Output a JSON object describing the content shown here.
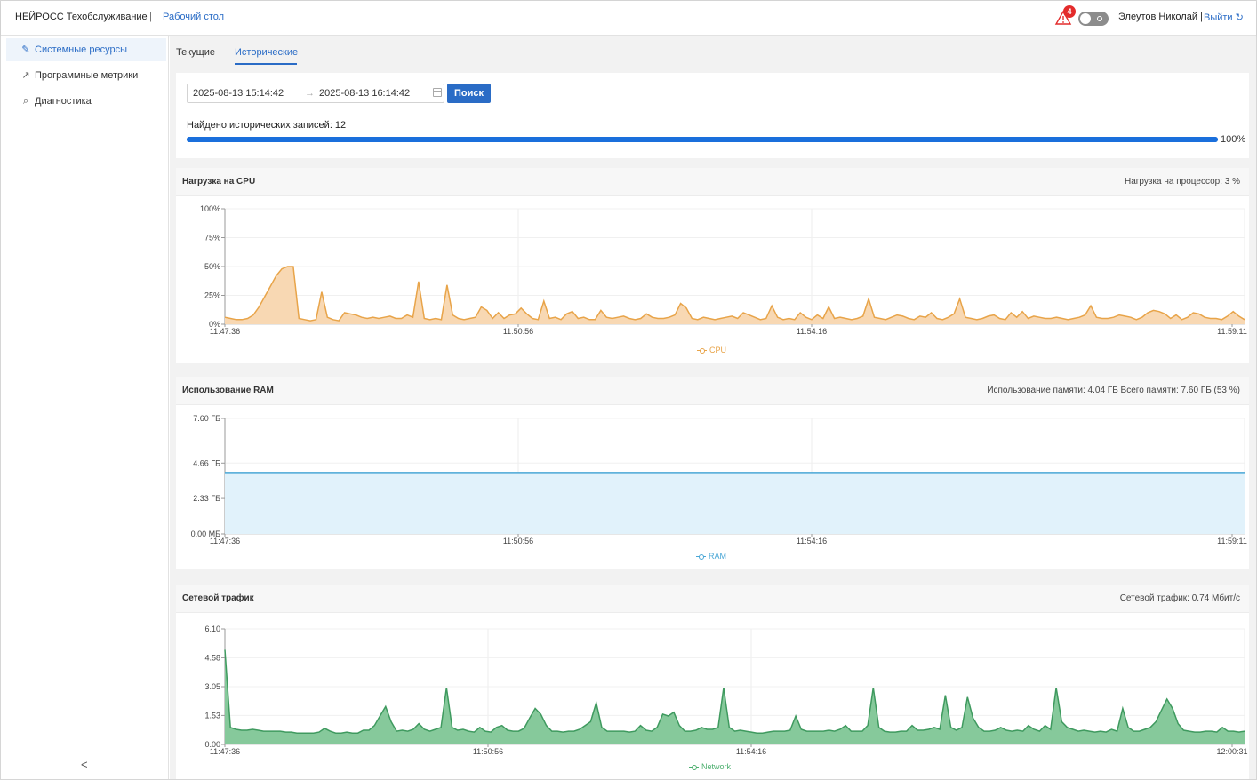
{
  "header": {
    "brand": "НЕЙРОСС Техобслуживание",
    "separator": "|",
    "desktop_link": "Рабочий стол",
    "alert_count": "4",
    "user": "Элеутов Николай |",
    "logout": "Выйти"
  },
  "sidebar": {
    "items": [
      {
        "label": "Системные ресурсы",
        "icon": "wrench-icon"
      },
      {
        "label": "Программные метрики",
        "icon": "line-chart-icon"
      },
      {
        "label": "Диагностика",
        "icon": "search-icon"
      }
    ],
    "collapse": "<"
  },
  "tabs": [
    {
      "label": "Текущие"
    },
    {
      "label": "Исторические"
    }
  ],
  "search": {
    "from": "2025-08-13 15:14:42",
    "arrow": "→",
    "to": "2025-08-13 16:14:42",
    "button": "Поиск",
    "found": "Найдено исторических записей: 12",
    "progress": 100,
    "progress_label": "100%"
  },
  "cpu": {
    "title": "Нагрузка на CPU",
    "meta": "Нагрузка на процессор: 3 %",
    "legend": "CPU",
    "color": "#e8a449"
  },
  "ram": {
    "title": "Использование RAM",
    "meta": "Использование памяти: 4.04 ГБ  Всего памяти: 7.60 ГБ  (53 %)",
    "legend": "RAM",
    "color": "#4aa7d6"
  },
  "net": {
    "title": "Сетевой трафик",
    "meta": "Сетевой трафик: 0.74 Мбит/с",
    "legend": "Network",
    "color": "#4caf6e"
  },
  "chart_data": [
    {
      "type": "area",
      "series": [
        {
          "name": "CPU",
          "values": [
            6,
            5,
            4,
            4,
            5,
            8,
            15,
            24,
            33,
            42,
            48,
            50,
            50,
            5,
            4,
            3,
            4,
            28,
            6,
            4,
            3,
            10,
            9,
            8,
            6,
            5,
            6,
            5,
            6,
            7,
            5,
            5,
            8,
            6,
            37,
            5,
            4,
            5,
            4,
            34,
            8,
            5,
            4,
            5,
            6,
            15,
            12,
            5,
            10,
            5,
            8,
            9,
            14,
            9,
            5,
            4,
            20,
            5,
            6,
            4,
            9,
            11,
            5,
            6,
            4,
            4,
            12,
            6,
            5,
            6,
            7,
            5,
            4,
            5,
            9,
            6,
            5,
            5,
            6,
            8,
            18,
            14,
            5,
            4,
            6,
            5,
            4,
            5,
            6,
            7,
            5,
            10,
            8,
            6,
            4,
            5,
            16,
            6,
            4,
            5,
            4,
            10,
            6,
            4,
            8,
            5,
            15,
            5,
            6,
            5,
            4,
            5,
            7,
            22,
            6,
            5,
            4,
            6,
            8,
            7,
            5,
            4,
            7,
            6,
            10,
            5,
            4,
            6,
            9,
            22,
            6,
            5,
            4,
            5,
            7,
            8,
            5,
            4,
            10,
            6,
            11,
            5,
            7,
            6,
            5,
            5,
            6,
            5,
            4,
            5,
            6,
            8,
            16,
            6,
            5,
            5,
            6,
            8,
            7,
            6,
            4,
            6,
            10,
            12,
            11,
            9,
            5,
            8,
            4,
            6,
            10,
            9,
            6,
            5,
            5,
            4,
            7,
            11,
            7,
            4
          ]
        }
      ],
      "x_tick_labels": [
        "11:47:36",
        "11:50:56",
        "11:54:16",
        "11:59:11"
      ],
      "y_tick_labels": [
        "0%",
        "25%",
        "50%",
        "75%",
        "100%"
      ],
      "ylim": [
        0,
        100
      ],
      "legend": "bottom-center"
    },
    {
      "type": "area",
      "series": [
        {
          "name": "RAM",
          "values": [
            4.04,
            4.04,
            4.04,
            4.04,
            4.04,
            4.04,
            4.04,
            4.04,
            4.04,
            4.04
          ]
        }
      ],
      "x_tick_labels": [
        "11:47:36",
        "11:50:56",
        "11:54:16",
        "11:59:11"
      ],
      "y_tick_labels": [
        "0.00 МБ",
        "2.33 ГБ",
        "4.66 ГБ",
        "7.60 ГБ"
      ],
      "ylim": [
        0,
        7.6
      ],
      "legend": "bottom-center"
    },
    {
      "type": "area",
      "series": [
        {
          "name": "Network",
          "values": [
            5.0,
            0.9,
            0.8,
            0.75,
            0.75,
            0.8,
            0.75,
            0.7,
            0.7,
            0.7,
            0.7,
            0.65,
            0.65,
            0.6,
            0.6,
            0.6,
            0.6,
            0.65,
            0.85,
            0.7,
            0.6,
            0.6,
            0.65,
            0.6,
            0.6,
            0.75,
            0.75,
            1.0,
            1.5,
            2.0,
            1.2,
            0.7,
            0.75,
            0.7,
            0.8,
            1.1,
            0.8,
            0.7,
            0.8,
            0.9,
            3.0,
            0.9,
            0.75,
            0.8,
            0.7,
            0.65,
            0.9,
            0.7,
            0.65,
            0.9,
            1.0,
            0.75,
            0.7,
            0.7,
            0.85,
            1.4,
            1.9,
            1.6,
            1.0,
            0.7,
            0.7,
            0.65,
            0.7,
            0.7,
            0.8,
            1.0,
            1.2,
            2.2,
            0.9,
            0.7,
            0.7,
            0.7,
            0.7,
            0.65,
            0.7,
            1.0,
            0.75,
            0.7,
            0.9,
            1.6,
            1.5,
            1.7,
            1.0,
            0.7,
            0.7,
            0.75,
            0.9,
            0.8,
            0.8,
            0.9,
            3.0,
            0.9,
            0.7,
            0.75,
            0.7,
            0.65,
            0.6,
            0.6,
            0.65,
            0.7,
            0.7,
            0.7,
            0.75,
            1.5,
            0.8,
            0.7,
            0.7,
            0.7,
            0.7,
            0.75,
            0.7,
            0.8,
            1.0,
            0.7,
            0.7,
            0.7,
            1.0,
            3.0,
            0.9,
            0.7,
            0.65,
            0.65,
            0.7,
            0.7,
            1.0,
            0.75,
            0.75,
            0.8,
            0.9,
            0.8,
            2.6,
            0.9,
            0.75,
            0.9,
            2.5,
            1.4,
            0.9,
            0.7,
            0.7,
            0.75,
            0.9,
            0.75,
            0.7,
            0.75,
            0.7,
            1.0,
            0.8,
            0.7,
            1.0,
            0.8,
            3.0,
            1.2,
            0.9,
            0.8,
            0.7,
            0.75,
            0.7,
            0.65,
            0.7,
            0.65,
            0.8,
            0.7,
            1.9,
            0.9,
            0.7,
            0.7,
            0.8,
            0.9,
            1.2,
            1.8,
            2.4,
            1.9,
            1.1,
            0.75,
            0.7,
            0.65,
            0.65,
            0.7,
            0.7,
            0.65,
            0.9,
            0.7,
            0.7,
            0.65,
            0.7
          ]
        }
      ],
      "x_tick_labels": [
        "11:47:36",
        "11:50:56",
        "11:54:16",
        "12:00:31"
      ],
      "y_tick_labels": [
        "0.00",
        "1.53",
        "3.05",
        "4.58",
        "6.10"
      ],
      "ylim": [
        0,
        6.1
      ],
      "legend": "bottom-center"
    }
  ]
}
